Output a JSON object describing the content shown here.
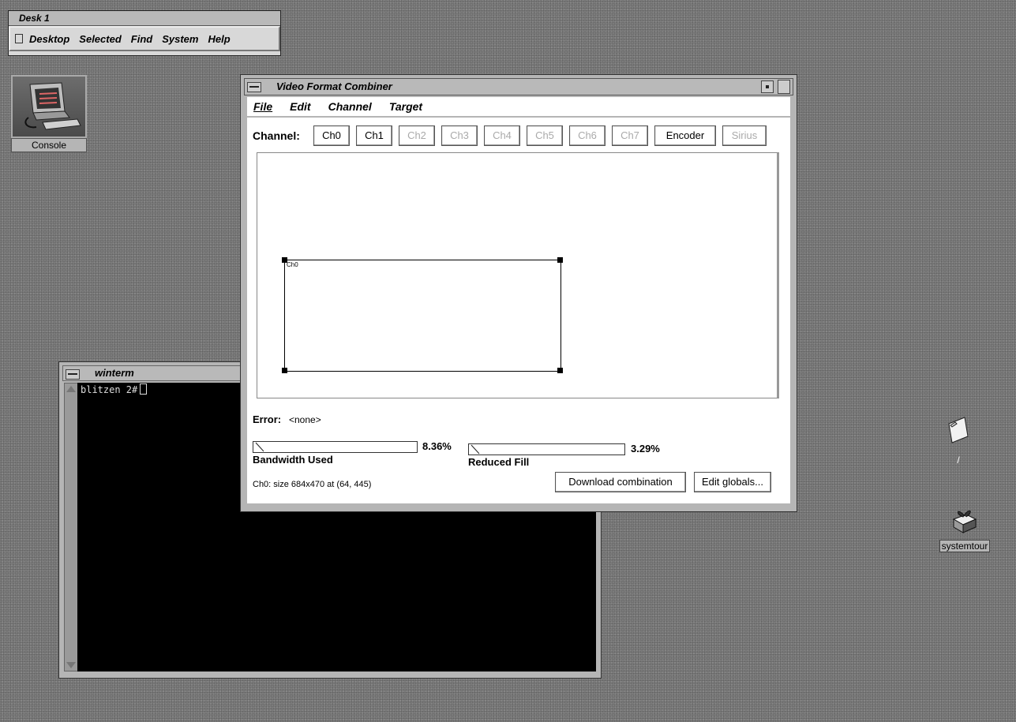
{
  "toolchest": {
    "title": "Desk 1",
    "menu": [
      "Desktop",
      "Selected",
      "Find",
      "System",
      "Help"
    ]
  },
  "desktop_icons": {
    "console": "Console",
    "root": "/",
    "systemtour": "systemtour"
  },
  "winterm": {
    "title": "winterm",
    "prompt": "blitzen 2#"
  },
  "vfc": {
    "title": "Video Format Combiner",
    "menu": [
      "File",
      "Edit",
      "Channel",
      "Target"
    ],
    "channel_label": "Channel:",
    "channels": [
      {
        "label": "Ch0",
        "enabled": true
      },
      {
        "label": "Ch1",
        "enabled": true
      },
      {
        "label": "Ch2",
        "enabled": false
      },
      {
        "label": "Ch3",
        "enabled": false
      },
      {
        "label": "Ch4",
        "enabled": false
      },
      {
        "label": "Ch5",
        "enabled": false
      },
      {
        "label": "Ch6",
        "enabled": false
      },
      {
        "label": "Ch7",
        "enabled": false
      },
      {
        "label": "Encoder",
        "enabled": true
      },
      {
        "label": "Sirius",
        "enabled": false
      }
    ],
    "canvas_channel_label": "Ch0",
    "error_label": "Error:",
    "error_value": "<none>",
    "bandwidth_value": "8.36%",
    "bandwidth_label": "Bandwidth Used",
    "bandwidth_fraction": 0.0836,
    "reduced_fill_value": "3.29%",
    "reduced_fill_label": "Reduced Fill",
    "reduced_fill_fraction": 0.0329,
    "status_text": "Ch0: size 684x470 at (64, 445)",
    "download_button": "Download combination",
    "edit_globals_button": "Edit globals..."
  }
}
